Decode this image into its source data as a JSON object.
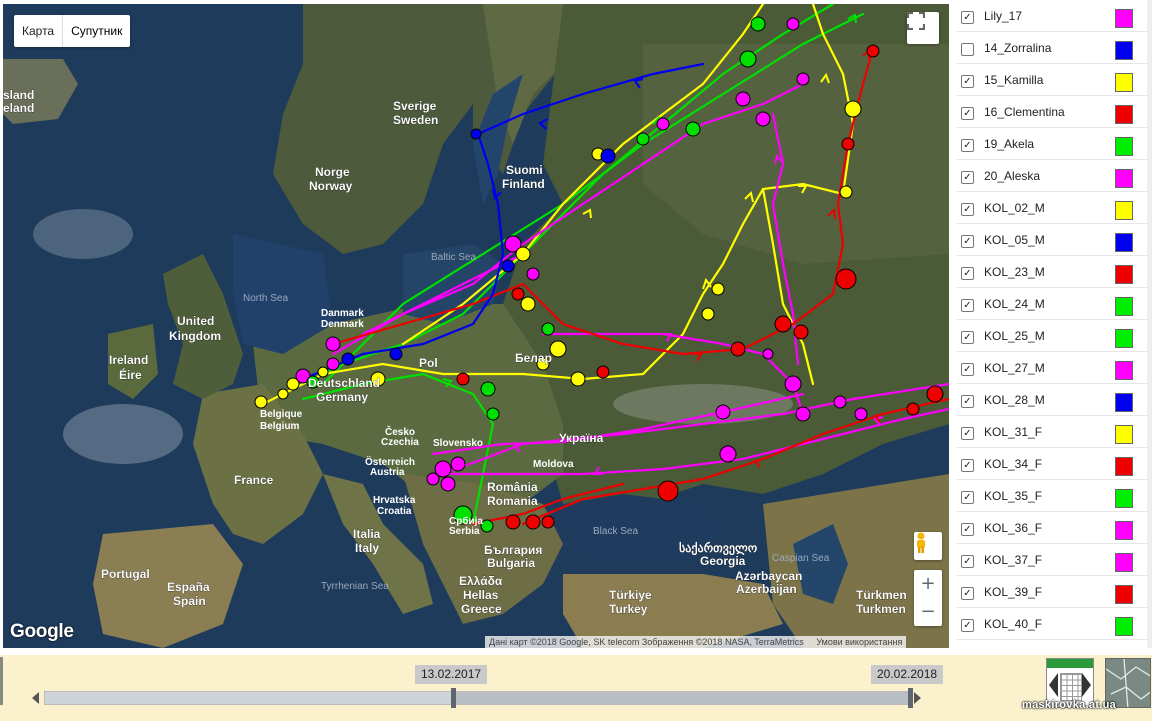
{
  "map": {
    "type_buttons": [
      "Карта",
      "Супутник"
    ],
    "google_logo": "Google",
    "attribution": "Дані карт ©2018 Google, SK telecom Зображення ©2018 NASA, TerraMetrics",
    "terms": "Умови використання",
    "labels": {
      "iceland": "sland\neland",
      "sverige": "Sverige",
      "sweden": "Sweden",
      "norge": "Norge",
      "norway": "Norway",
      "suomi": "Suomi",
      "finland": "Finland",
      "baltic": "Baltic Sea",
      "north_sea": "North Sea",
      "denmark1": "Danmark",
      "denmark2": "Denmark",
      "uk1": "United",
      "uk2": "Kingdom",
      "ireland1": "Ireland",
      "ireland2": "Éire",
      "deutschland": "Deutschland",
      "germany": "Germany",
      "belgique": "Belgique",
      "belgium": "Belgium",
      "pol": "Pol",
      "bela": "Белар",
      "cesko": "Česko",
      "czechia": "Czechia",
      "slovensko": "Slovensko",
      "ukraina": "Україна",
      "osterreich": "Österreich",
      "austria": "Austria",
      "moldova": "Moldova",
      "france": "France",
      "romania1": "România",
      "romania2": "Romania",
      "hrvatska": "Hrvatska",
      "croatia": "Croatia",
      "srbija": "Србија",
      "serbia": "Serbia",
      "italia1": "Italia",
      "italia2": "Italy",
      "bulgaria1": "България",
      "bulgaria2": "Bulgaria",
      "black_sea": "Black Sea",
      "georgia1": "საქართველო",
      "georgia2": "Georgia",
      "caspian": "Caspian Sea",
      "azer1": "Azərbaycan",
      "azer2": "Azerbaijan",
      "portugal": "Portugal",
      "espana": "España",
      "spain": "Spain",
      "tyrrhenian": "Tyrrhenian Sea",
      "ellada": "Ελλάδα",
      "hellas": "Hellas",
      "greece": "Greece",
      "turkiye": "Türkiye",
      "turkey": "Turkey",
      "turkmen1": "Türkmen",
      "turkmen2": "Turkmen"
    }
  },
  "legend": [
    {
      "name": "Lily_17",
      "checked": true,
      "color": "#ff00ff"
    },
    {
      "name": "14_Zorralina",
      "checked": false,
      "color": "#0000ee"
    },
    {
      "name": "15_Kamilla",
      "checked": true,
      "color": "#ffff00"
    },
    {
      "name": "16_Clementina",
      "checked": true,
      "color": "#ee0000"
    },
    {
      "name": "19_Akela",
      "checked": true,
      "color": "#00ee00"
    },
    {
      "name": "20_Aleska",
      "checked": true,
      "color": "#ff00ff"
    },
    {
      "name": "KOL_02_M",
      "checked": true,
      "color": "#ffff00"
    },
    {
      "name": "KOL_05_M",
      "checked": true,
      "color": "#0000ee"
    },
    {
      "name": "KOL_23_M",
      "checked": true,
      "color": "#ee0000"
    },
    {
      "name": "KOL_24_M",
      "checked": true,
      "color": "#00ee00"
    },
    {
      "name": "KOL_25_M",
      "checked": true,
      "color": "#00ee00"
    },
    {
      "name": "KOL_27_M",
      "checked": true,
      "color": "#ff00ff"
    },
    {
      "name": "KOL_28_M",
      "checked": true,
      "color": "#0000ee"
    },
    {
      "name": "KOL_31_F",
      "checked": true,
      "color": "#ffff00"
    },
    {
      "name": "KOL_34_F",
      "checked": true,
      "color": "#ee0000"
    },
    {
      "name": "KOL_35_F",
      "checked": true,
      "color": "#00ee00"
    },
    {
      "name": "KOL_36_F",
      "checked": true,
      "color": "#ff00ff"
    },
    {
      "name": "KOL_37_F",
      "checked": true,
      "color": "#ff00ff"
    },
    {
      "name": "KOL_39_F",
      "checked": true,
      "color": "#ee0000"
    },
    {
      "name": "KOL_40_F",
      "checked": true,
      "color": "#00ee00"
    },
    {
      "name": "",
      "checked": true,
      "color": "#ffff00"
    }
  ],
  "timeline": {
    "start_date": "13.02.2017",
    "end_date": "20.02.2018"
  },
  "watermark": "maskirovka.at.ua"
}
